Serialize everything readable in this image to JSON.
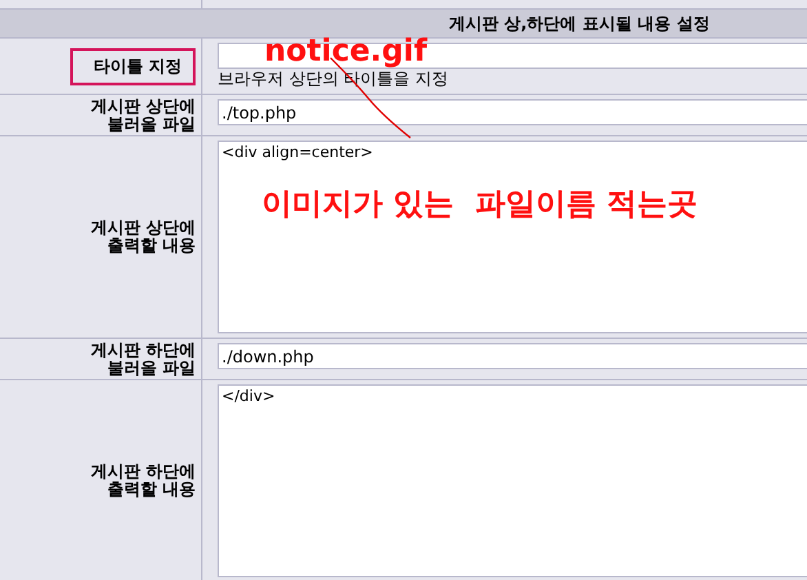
{
  "header": {
    "title": "게시판 상,하단에 표시될 내용 설정"
  },
  "rows": [
    {
      "label": "타이틀 지정",
      "kind": "input",
      "value": "",
      "hint": "브라우저 상단의 타이틀을 지정",
      "highlighted": true
    },
    {
      "label": "게시판 상단에\n불러올 파일",
      "kind": "input",
      "value": "./top.php",
      "highlighted": false
    },
    {
      "label": "게시판 상단에\n출력할 내용",
      "kind": "textarea",
      "value": "<div align=center>",
      "highlighted": false
    },
    {
      "label": "게시판 하단에\n불러올 파일",
      "kind": "input",
      "value": "./down.php",
      "highlighted": false
    },
    {
      "label": "게시판 하단에\n출력할 내용",
      "kind": "textarea",
      "value": "</div>",
      "highlighted": false
    }
  ],
  "annotations": [
    {
      "text": "notice.gif"
    },
    {
      "text": "이미지가 있는  파일이름 적는곳"
    }
  ]
}
